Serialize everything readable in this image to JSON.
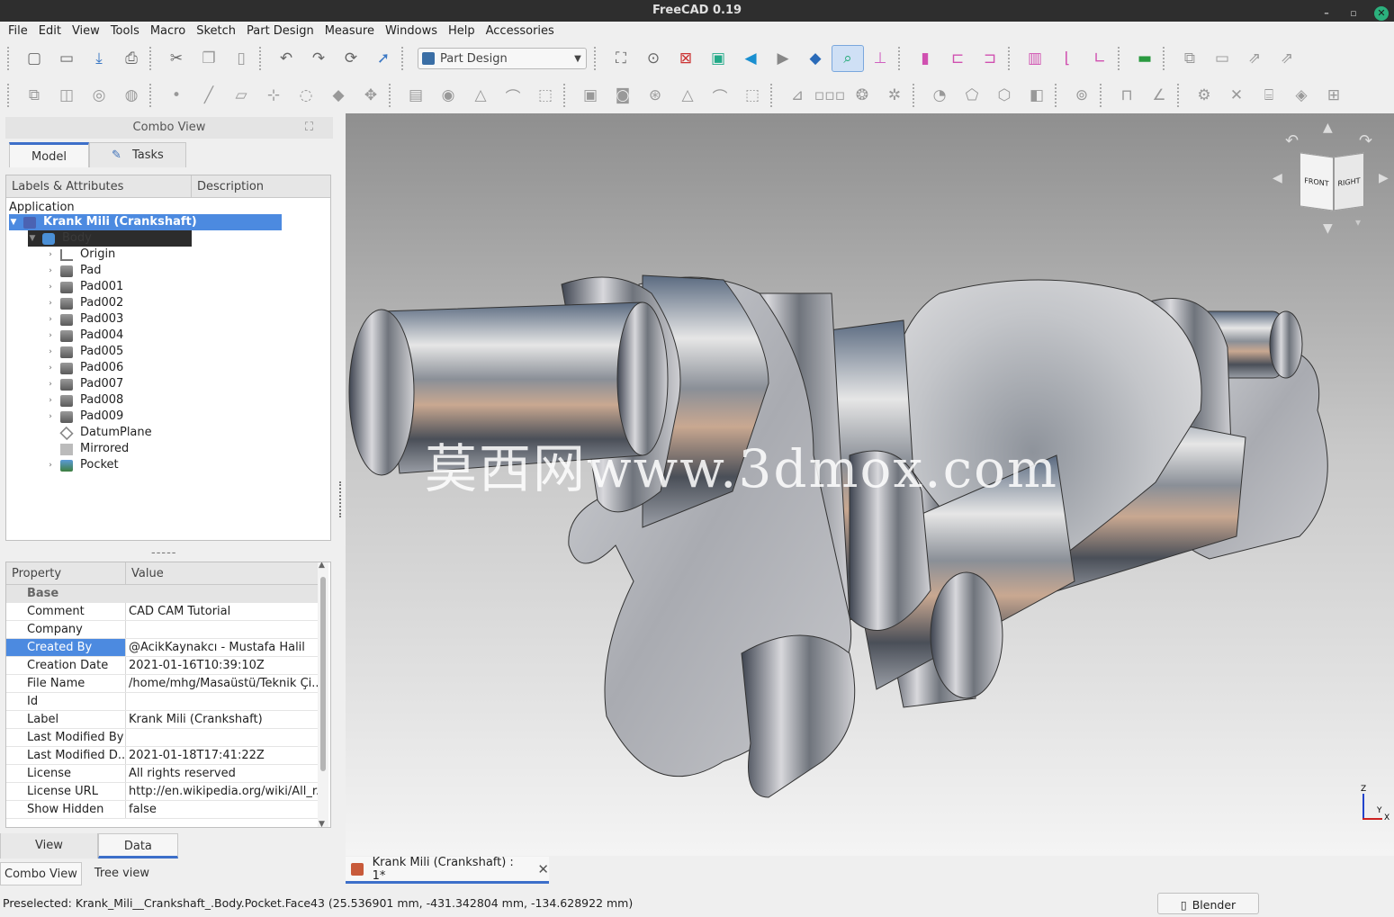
{
  "window": {
    "title": "FreeCAD 0.19"
  },
  "menu": [
    "File",
    "Edit",
    "View",
    "Tools",
    "Macro",
    "Sketch",
    "Part Design",
    "Measure",
    "Windows",
    "Help",
    "Accessories"
  ],
  "workbench": {
    "selected": "Part Design"
  },
  "combo": {
    "title": "Combo View",
    "tabs": [
      "Model",
      "Tasks"
    ],
    "tree_headers": [
      "Labels & Attributes",
      "Description"
    ],
    "tree": {
      "section": "Application",
      "document": "Krank Mili (Crankshaft)",
      "body": "Body",
      "items": [
        "Origin",
        "Pad",
        "Pad001",
        "Pad002",
        "Pad003",
        "Pad004",
        "Pad005",
        "Pad006",
        "Pad007",
        "Pad008",
        "Pad009",
        "DatumPlane",
        "Mirrored",
        "Pocket"
      ]
    },
    "splitter": "-----",
    "prop_headers": [
      "Property",
      "Value"
    ],
    "prop_group": "Base",
    "props": [
      {
        "k": "Comment",
        "v": "CAD CAM Tutorial"
      },
      {
        "k": "Company",
        "v": ""
      },
      {
        "k": "Created By",
        "v": "@AcikKaynakcı - Mustafa Halil"
      },
      {
        "k": "Creation Date",
        "v": "2021-01-16T10:39:10Z"
      },
      {
        "k": "File Name",
        "v": "/home/mhg/Masaüstü/Teknik Çi..."
      },
      {
        "k": "Id",
        "v": ""
      },
      {
        "k": "Label",
        "v": "Krank Mili (Crankshaft)"
      },
      {
        "k": "Last Modified By",
        "v": ""
      },
      {
        "k": "Last Modified D...",
        "v": "2021-01-18T17:41:22Z"
      },
      {
        "k": "License",
        "v": "All rights reserved"
      },
      {
        "k": "License URL",
        "v": "http://en.wikipedia.org/wiki/All_r..."
      },
      {
        "k": "Show Hidden",
        "v": "false"
      }
    ],
    "view_tabs": [
      "View",
      "Data"
    ],
    "bottom_tabs": [
      "Combo View",
      "Tree view"
    ]
  },
  "viewport": {
    "watermark": "莫西网www.3dmox.com",
    "navcube": {
      "front": "FRONT",
      "right": "RIGHT"
    },
    "axis": {
      "z": "Z",
      "y": "Y",
      "x": "X"
    }
  },
  "document_tab": {
    "label": "Krank Mili (Crankshaft) : 1*"
  },
  "status": {
    "text": "Preselected: Krank_Mili__Crankshaft_.Body.Pocket.Face43 (25.536901 mm, -431.342804 mm, -134.628922 mm)",
    "nav_style": "Blender"
  }
}
